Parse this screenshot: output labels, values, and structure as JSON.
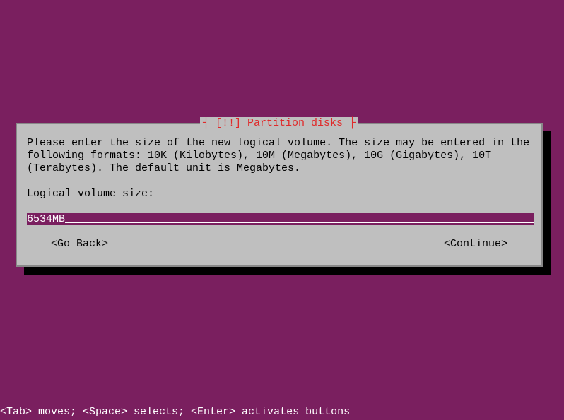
{
  "dialog": {
    "title": "[!!] Partition disks",
    "prompt": "Please enter the size of the new logical volume. The size may be entered in the following formats: 10K (Kilobytes), 10M (Megabytes), 10G (Gigabytes), 10T (Terabytes). The default unit is Megabytes.",
    "field_label": "Logical volume size:",
    "input_value": "6534MB",
    "buttons": {
      "back": "<Go Back>",
      "continue": "<Continue>"
    }
  },
  "footer": {
    "hint": "<Tab> moves; <Space> selects; <Enter> activates buttons"
  }
}
